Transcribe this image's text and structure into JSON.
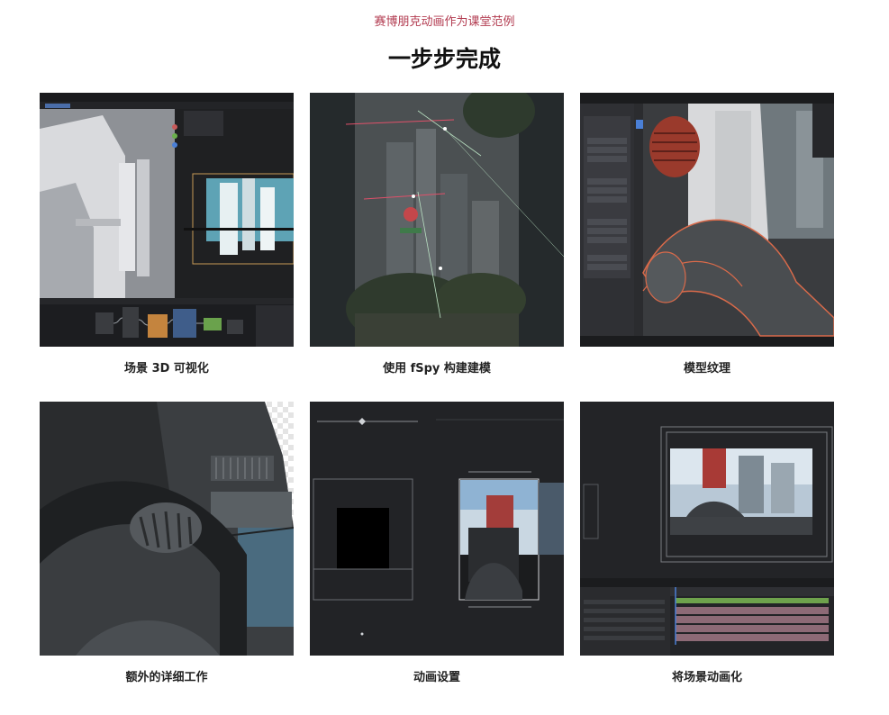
{
  "section": {
    "kicker": "赛博朋克动画作为课堂范例",
    "heading": "一步步完成"
  },
  "steps": [
    {
      "caption": "场景 3D 可视化"
    },
    {
      "caption": "使用 fSpy 构建建模"
    },
    {
      "caption": "模型纹理"
    },
    {
      "caption": "额外的详细工作"
    },
    {
      "caption": "动画设置"
    },
    {
      "caption": "将场景动画化"
    }
  ]
}
